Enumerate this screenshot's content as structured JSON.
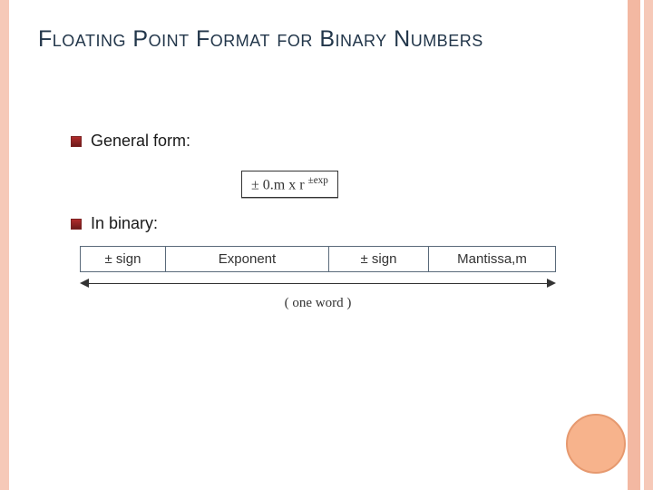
{
  "title": "Floating Point Format for Binary Numbers",
  "bullets": {
    "general": "General form:",
    "binary": "In binary:"
  },
  "formula": {
    "pm1": "±",
    "body": " 0.m x r ",
    "pm2": "±",
    "exp": "exp"
  },
  "fields": {
    "sign1": "± sign",
    "exponent": "Exponent",
    "sign2": "± sign",
    "mantissa": "Mantissa,m"
  },
  "caption": "( one word )",
  "colors": {
    "accent_stripe": "#f6c9b8",
    "bullet": "#b02b2b",
    "circle": "#f7b38c"
  }
}
